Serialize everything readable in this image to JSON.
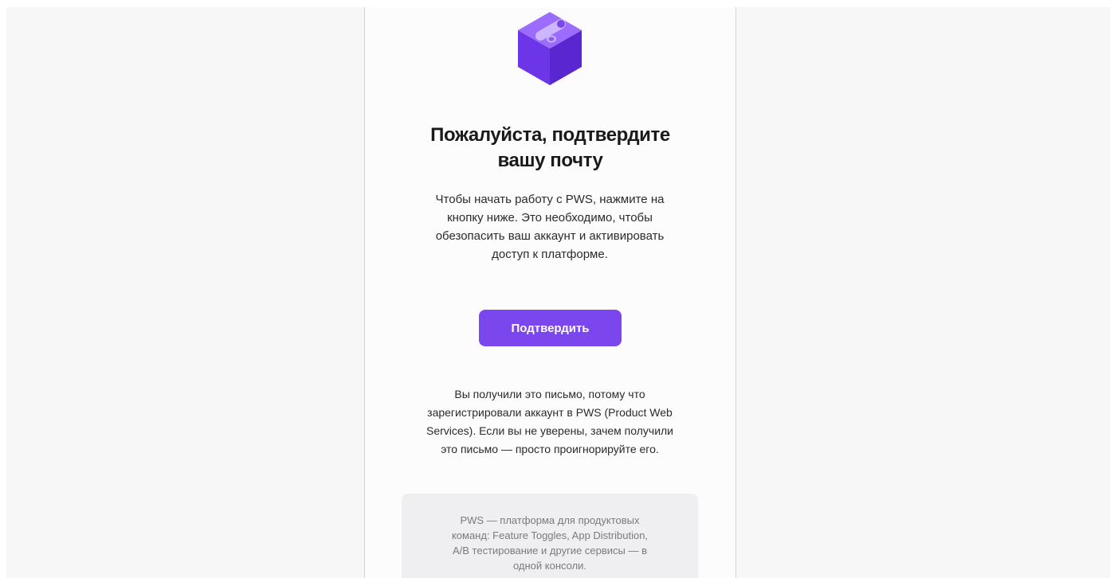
{
  "colors": {
    "page_background": "#f7f7f8",
    "card_background": "#fcfcfd",
    "accent": "#7b46ee",
    "footer_background": "#efeef1"
  },
  "logo": {
    "icon": "purple-toggle-cube-icon"
  },
  "heading": {
    "line1": "Пожалуйста, подтвердите",
    "line2": "вашу почту"
  },
  "intro": {
    "lines": [
      "Чтобы начать работу с PWS, нажмите на",
      "кнопку ниже. Это необходимо, чтобы",
      "обезопасить ваш аккаунт и активировать",
      "доступ к платформе."
    ]
  },
  "confirm_button": {
    "label": "Подтвердить"
  },
  "notice": {
    "lines": [
      "Вы получили это письмо, потому что",
      "зарегистрировали аккаунт в PWS (Product Web",
      "Services). Если вы не уверены, зачем получили",
      "это письмо — просто проигнорируйте его."
    ]
  },
  "footer": {
    "lines": [
      "PWS — платформа для продуктовых",
      "команд: Feature Toggles, App Distribution,",
      "A/B тестирование и другие сервисы — в",
      "одной консоли."
    ]
  }
}
